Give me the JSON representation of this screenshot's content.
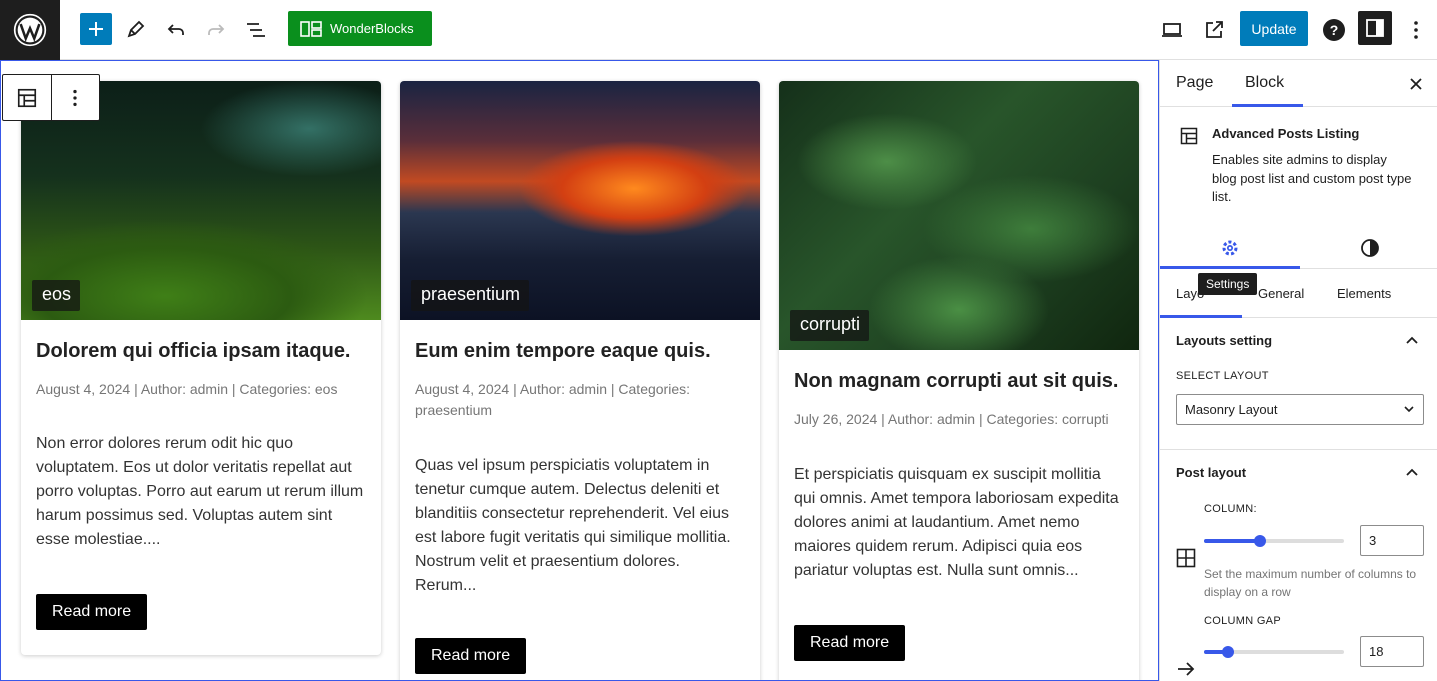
{
  "toolbar": {
    "wonderblocks_label": "WonderBlocks",
    "update_label": "Update",
    "icons": [
      "wordpress-logo-icon",
      "plus-icon",
      "pencil-icon",
      "undo-icon",
      "redo-icon",
      "document-overview-icon",
      "desktop-preview-icon",
      "external-view-icon",
      "help-icon",
      "sidebar-toggle-icon",
      "more-options-icon"
    ]
  },
  "colors": {
    "accent": "#007cba",
    "wonderblocks": "#0a8f1d",
    "focus": "#3858e9"
  },
  "posts": [
    {
      "tag": "eos",
      "title": "Dolorem qui officia ipsam itaque.",
      "meta": "August 4, 2024 | Author: admin | Categories: eos",
      "excerpt": "Non error dolores rerum odit hic quo voluptatem. Eos ut dolor veritatis repellat aut porro voluptas. Porro aut earum ut rerum illum harum possimus sed. Voluptas autem sint esse molestiae....",
      "button": "Read more"
    },
    {
      "tag": "praesentium",
      "title": "Eum enim tempore eaque quis.",
      "meta": "August 4, 2024 | Author: admin | Categories: praesentium",
      "excerpt": "Quas vel ipsum perspiciatis voluptatem in tenetur cumque autem. Delectus deleniti et blanditiis consectetur reprehenderit. Vel eius est labore fugit veritatis qui similique mollitia. Nostrum velit et praesentium dolores. Rerum...",
      "button": "Read more"
    },
    {
      "tag": "corrupti",
      "title": "Non magnam corrupti aut sit quis.",
      "meta": "July 26, 2024 | Author: admin | Categories: corrupti",
      "excerpt": "Et perspiciatis quisquam ex suscipit mollitia qui omnis. Amet tempora laboriosam expedita dolores animi at laudantium. Amet nemo maiores quidem rerum. Adipisci quia eos pariatur voluptas est. Nulla sunt omnis...",
      "button": "Read more"
    }
  ],
  "sidebar": {
    "tab_page": "Page",
    "tab_block": "Block",
    "block_title": "Advanced Posts Listing",
    "block_desc": "Enables site admins to display blog post list and custom post type list.",
    "tooltip": "Settings",
    "sub_tab_layout": "Layo",
    "sub_tab_general": "General",
    "sub_tab_elements": "Elements",
    "layouts_setting": "Layouts setting",
    "select_layout_label": "SELECT LAYOUT",
    "select_layout_value": "Masonry Layout",
    "post_layout": "Post layout",
    "column_label": "COLUMN:",
    "column_value": "3",
    "column_slider_fraction": 0.4,
    "column_help": "Set the maximum number of columns to display on a row",
    "gap_label": "COLUMN GAP",
    "gap_value": "18",
    "gap_slider_fraction": 0.17
  }
}
